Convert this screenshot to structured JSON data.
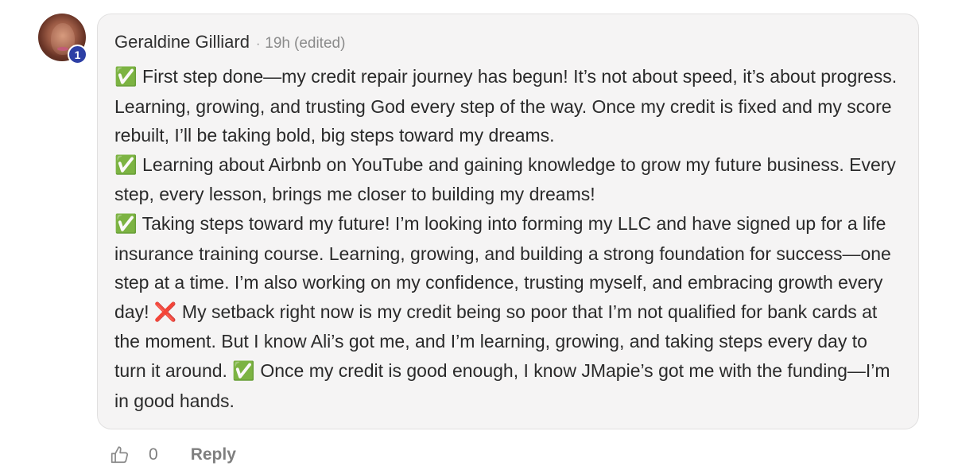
{
  "comment": {
    "author": "Geraldine Gilliard",
    "separator": "·",
    "time": "19h",
    "edited_label": "(edited)",
    "level": "1",
    "paragraphs": [
      {
        "icon": "✅",
        "text": "First step done—my credit repair journey has begun! It’s not about speed, it’s about progress. Learning, growing, and trusting God every step of the way. Once my credit is fixed and my score rebuilt, I’ll be taking bold, big steps toward my dreams."
      },
      {
        "icon": "✅",
        "text": "Learning about Airbnb on YouTube and gaining knowledge to grow my future business. Every step, every lesson, brings me closer to building my dreams!"
      },
      {
        "icon": "✅",
        "text": "Taking steps toward my future! I’m looking into forming my LLC and have signed up for a life insurance training course. Learning, growing, and building a strong foundation for success—one step at a time. I’m also working on my confidence, trusting myself, and embracing growth every day!",
        "icon2": "❌",
        "text2": "My setback right now is my credit being so poor that I’m not qualified for bank cards at the moment. But I know Ali’s got me, and I’m learning, growing, and taking steps every day to turn it around.",
        "icon3": "✅",
        "text3": "Once my credit is good enough, I know JMapie’s got me with the funding—I’m in good hands."
      }
    ]
  },
  "actions": {
    "like_icon": "thumbs-up-icon",
    "like_count": "0",
    "reply_label": "Reply"
  },
  "colors": {
    "bubble_background": "#f5f4f4",
    "badge": "#2d3fa5",
    "check": "#3aa23a",
    "cross": "#e0312e"
  }
}
